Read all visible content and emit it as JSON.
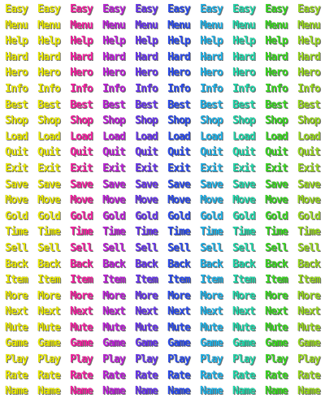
{
  "sprite_sheet": {
    "words": [
      "Easy",
      "Menu",
      "Help",
      "Hard",
      "Hero",
      "Info",
      "Best",
      "Shop",
      "Load",
      "Quit",
      "Exit",
      "Save",
      "Move",
      "Gold",
      "Time",
      "Sell",
      "Back",
      "Item",
      "More",
      "Next",
      "Mute",
      "Game",
      "Play",
      "Rate",
      "Name"
    ],
    "column_colors": [
      "#f2f200",
      "#f2f200",
      "#ff1fa6",
      "#c21fe0",
      "#6a35f5",
      "#2a4cf5",
      "#1fb8f0",
      "#1fe0b0",
      "#3ae01f",
      "#9de01f"
    ]
  }
}
